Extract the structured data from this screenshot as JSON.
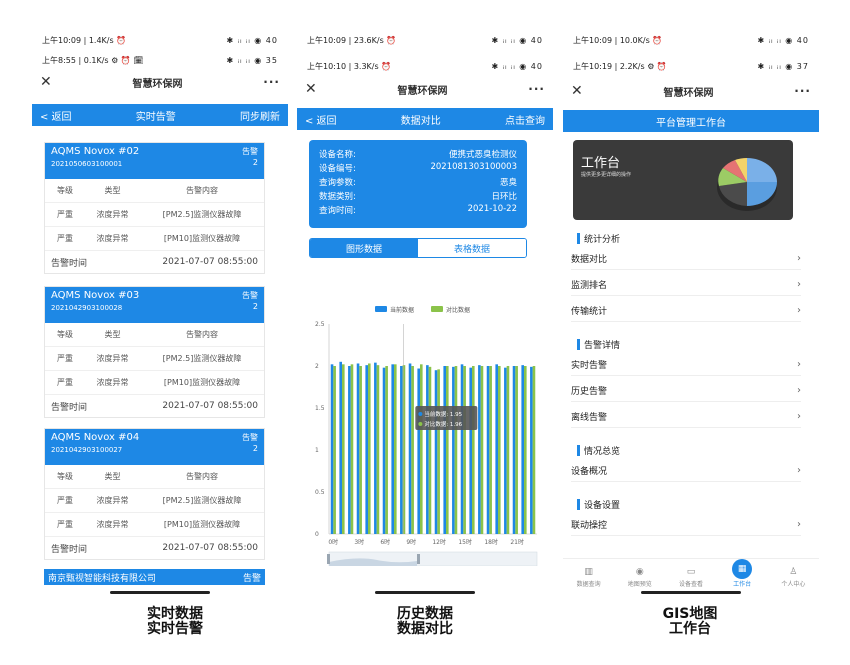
{
  "phone1": {
    "status_back": "上午10:09 | 1.4K/s ⏰",
    "status_back_right": "✱ ᵢₗ ᵢₗ ◉ 40",
    "status_front": "上午8:55 | 0.1K/s ⚙ ⏰ 🗓",
    "status_front_right": "✱ ᵢₗ ᵢₗ ◉ 35",
    "app_title": "智慧环保网",
    "nav_back": "< 返回",
    "nav_title": "实时告警",
    "nav_action": "同步刷新",
    "headers": {
      "level": "等级",
      "type": "类型",
      "content": "告警内容"
    },
    "time_label": "告警时间",
    "alarm_label": "告警",
    "cards": [
      {
        "device": "AQMS Novox #02",
        "code": "2021050603100001",
        "count": "2",
        "rows": [
          {
            "level": "严重",
            "type": "浓度异常",
            "content": "[PM2.5]监测仪器故障"
          },
          {
            "level": "严重",
            "type": "浓度异常",
            "content": "[PM10]监测仪器故障"
          }
        ],
        "time": "2021-07-07 08:55:00"
      },
      {
        "device": "AQMS Novox #03",
        "code": "2021042903100028",
        "count": "2",
        "rows": [
          {
            "level": "严重",
            "type": "浓度异常",
            "content": "[PM2.5]监测仪器故障"
          },
          {
            "level": "严重",
            "type": "浓度异常",
            "content": "[PM10]监测仪器故障"
          }
        ],
        "time": "2021-07-07 08:55:00"
      },
      {
        "device": "AQMS Novox #04",
        "code": "2021042903100027",
        "count": "2",
        "rows": [
          {
            "level": "严重",
            "type": "浓度异常",
            "content": "[PM2.5]监测仪器故障"
          },
          {
            "level": "严重",
            "type": "浓度异常",
            "content": "[PM10]监测仪器故障"
          }
        ],
        "time": "2021-07-07 08:55:00"
      }
    ],
    "company": "南京甄视智能科技有限公司",
    "company_alarm": "告警"
  },
  "phone2": {
    "status_back": "上午10:09 | 23.6K/s ⏰",
    "status_back_right": "✱ ᵢₗ ᵢₗ ◉ 40",
    "status_front": "上午10:10 | 3.3K/s ⏰",
    "status_front_right": "✱ ᵢₗ ᵢₗ ◉ 40",
    "app_title": "智慧环保网",
    "nav_back": "< 返回",
    "nav_title": "数据对比",
    "nav_action": "点击查询",
    "info": [
      {
        "label": "设备名称:",
        "value": "便携式恶臭检测仪"
      },
      {
        "label": "设备编号:",
        "value": "2021081303100003"
      },
      {
        "label": "查询参数:",
        "value": "恶臭"
      },
      {
        "label": "数据类别:",
        "value": "日环比"
      },
      {
        "label": "查询时间:",
        "value": "2021-10-22"
      }
    ],
    "seg_active": "图形数据",
    "seg_inactive": "表格数据",
    "tooltip_current": "当前数据: 1.95",
    "tooltip_compare": "对比数据: 1.96"
  },
  "chart_data": {
    "type": "bar",
    "series": [
      {
        "name": "当前数据",
        "color": "#1e88e5",
        "values": [
          2.02,
          2.05,
          2.0,
          2.03,
          2.01,
          2.04,
          1.98,
          2.02,
          2.0,
          2.03,
          1.97,
          2.01,
          1.95,
          2.0,
          1.99,
          2.02,
          1.98,
          2.01,
          2.0,
          2.02,
          1.98,
          2.0,
          2.01,
          1.99
        ]
      },
      {
        "name": "对比数据",
        "color": "#8bc34a",
        "values": [
          2.0,
          2.02,
          2.02,
          2.0,
          2.03,
          2.01,
          2.0,
          2.02,
          2.01,
          2.0,
          2.02,
          1.99,
          1.96,
          2.0,
          2.0,
          2.0,
          2.0,
          2.0,
          2.0,
          2.0,
          2.0,
          2.0,
          2.0,
          2.0
        ]
      }
    ],
    "x_tick_labels": [
      "0时",
      "3时",
      "6时",
      "9时",
      "12时",
      "15时",
      "18时",
      "21时"
    ],
    "y_ticks": [
      0,
      0.5,
      1,
      1.5,
      2,
      2.5
    ],
    "ylim": [
      0,
      2.5
    ],
    "legend_position": "top-center",
    "grid": false
  },
  "phone3": {
    "status_back": "上午10:09 | 10.0K/s ⏰",
    "status_back_right": "✱ ᵢₗ ᵢₗ ◉ 40",
    "status_front": "上午10:19 | 2.2K/s ⚙ ⏰",
    "status_front_right": "✱ ᵢₗ ᵢₗ ◉ 37",
    "app_title": "智慧环保网",
    "banner": "平台管理工作台",
    "wb_title": "工作台",
    "wb_sub": "提供更多更详细的操作",
    "sections": [
      {
        "title": "统计分析",
        "items": [
          "数据对比",
          "监测排名",
          "传输统计"
        ]
      },
      {
        "title": "告警详情",
        "items": [
          "实时告警",
          "历史告警",
          "离线告警"
        ]
      },
      {
        "title": "情况总览",
        "items": [
          "设备概况"
        ]
      },
      {
        "title": "设备设置",
        "items": [
          "联动操控"
        ]
      }
    ],
    "tabs": [
      {
        "label": "数据查询",
        "icon": "chart-icon"
      },
      {
        "label": "地图预览",
        "icon": "map-pin-icon"
      },
      {
        "label": "设备查看",
        "icon": "monitor-icon"
      },
      {
        "label": "工作台",
        "icon": "grid-icon"
      },
      {
        "label": "个人中心",
        "icon": "user-icon"
      }
    ],
    "accent": "#1e88e5"
  },
  "captions": {
    "c1_back": "实时数据",
    "c1_front": "实时告警",
    "c2_back": "历史数据",
    "c2_front": "数据对比",
    "c3_back": "GIS地图",
    "c3_front": "工作台"
  }
}
